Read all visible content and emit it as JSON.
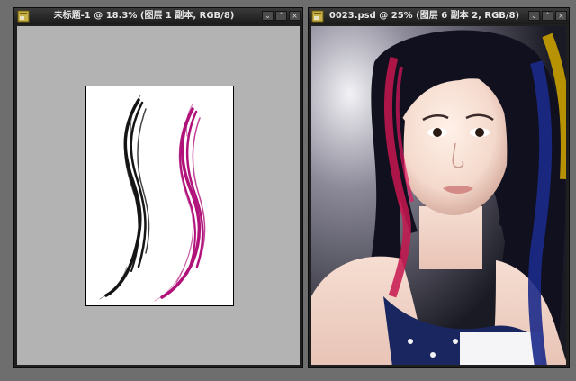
{
  "colors": {
    "workspace": "#6e6e6e",
    "window_frame": "#1f1f1f",
    "canvas_gray": "#b3b3b3",
    "brush_black": "#151515",
    "brush_magenta": "#b0127a",
    "streak_blue": "#1c2a8a",
    "streak_gold": "#c9a000"
  },
  "windows": [
    {
      "title": "未标题-1 @ 18.3% (图层 1 副本, RGB/8)",
      "icon": "photoshop-document-icon",
      "controls": [
        "⌄",
        "˄",
        "×"
      ]
    },
    {
      "title": "0023.psd @ 25% (图层 6 副本 2, RGB/8)",
      "icon": "photoshop-document-icon",
      "controls": [
        "⌄",
        "˄",
        "×"
      ]
    }
  ]
}
